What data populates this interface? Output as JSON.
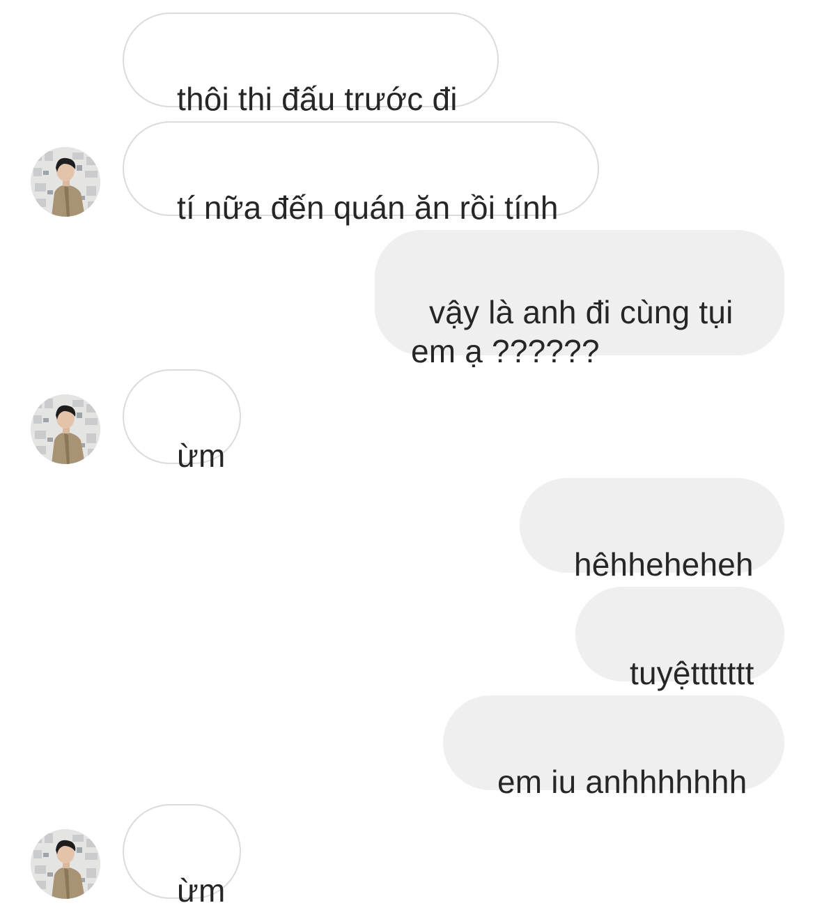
{
  "colors": {
    "incoming_bubble_bg": "#ffffff",
    "incoming_bubble_border": "#dbdbdb",
    "outgoing_bubble_bg": "#efefef",
    "text": "#262626"
  },
  "contact": {
    "avatar_icon": "profile-photo-avatar"
  },
  "messages": [
    {
      "from": "them",
      "text": "thôi thi đấu trước đi"
    },
    {
      "from": "them",
      "text": "tí nữa đến quán ăn rồi tính"
    },
    {
      "from": "me",
      "text": "vậy là anh đi cùng tụi em ạ ??????"
    },
    {
      "from": "them",
      "text": "ừm"
    },
    {
      "from": "me",
      "text": "hêhheheheh"
    },
    {
      "from": "me",
      "text": "tuyệttttttt"
    },
    {
      "from": "me",
      "text": "em iu anhhhhhhh"
    },
    {
      "from": "them",
      "text": "ừm"
    }
  ]
}
